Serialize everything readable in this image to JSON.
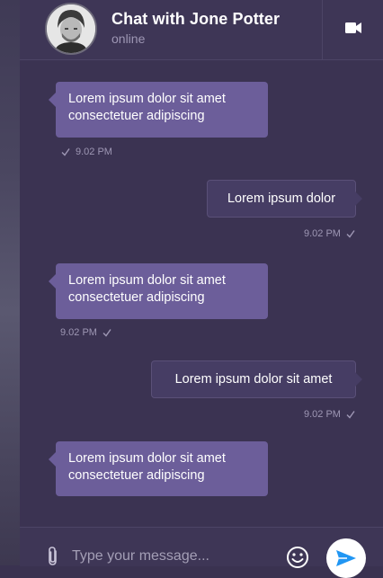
{
  "header": {
    "title": "Chat with Jone Potter",
    "status": "online",
    "video_icon": "video-camera-icon"
  },
  "messages": [
    {
      "direction": "incoming",
      "text": "Lorem ipsum dolor sit amet consectetuer adipiscing",
      "time": "9.02 PM"
    },
    {
      "direction": "outgoing",
      "text": "Lorem ipsum dolor",
      "time": "9.02 PM"
    },
    {
      "direction": "incoming",
      "text": "Lorem ipsum dolor sit amet consectetuer adipiscing",
      "time": "9.02 PM"
    },
    {
      "direction": "outgoing",
      "text": "Lorem ipsum dolor sit amet",
      "time": "9.02 PM"
    },
    {
      "direction": "incoming",
      "text": "Lorem ipsum dolor sit amet consectetuer adipiscing",
      "time": null
    }
  ],
  "composer": {
    "placeholder": "Type your message...",
    "attach_icon": "paperclip-icon",
    "emoji_icon": "smiley-icon",
    "send_icon": "send-icon"
  },
  "colors": {
    "panel_bg": "#3b3352",
    "incoming_bubble": "#6c5e9a",
    "outgoing_bubble": "#463d64",
    "send_accent": "#2196f3"
  }
}
